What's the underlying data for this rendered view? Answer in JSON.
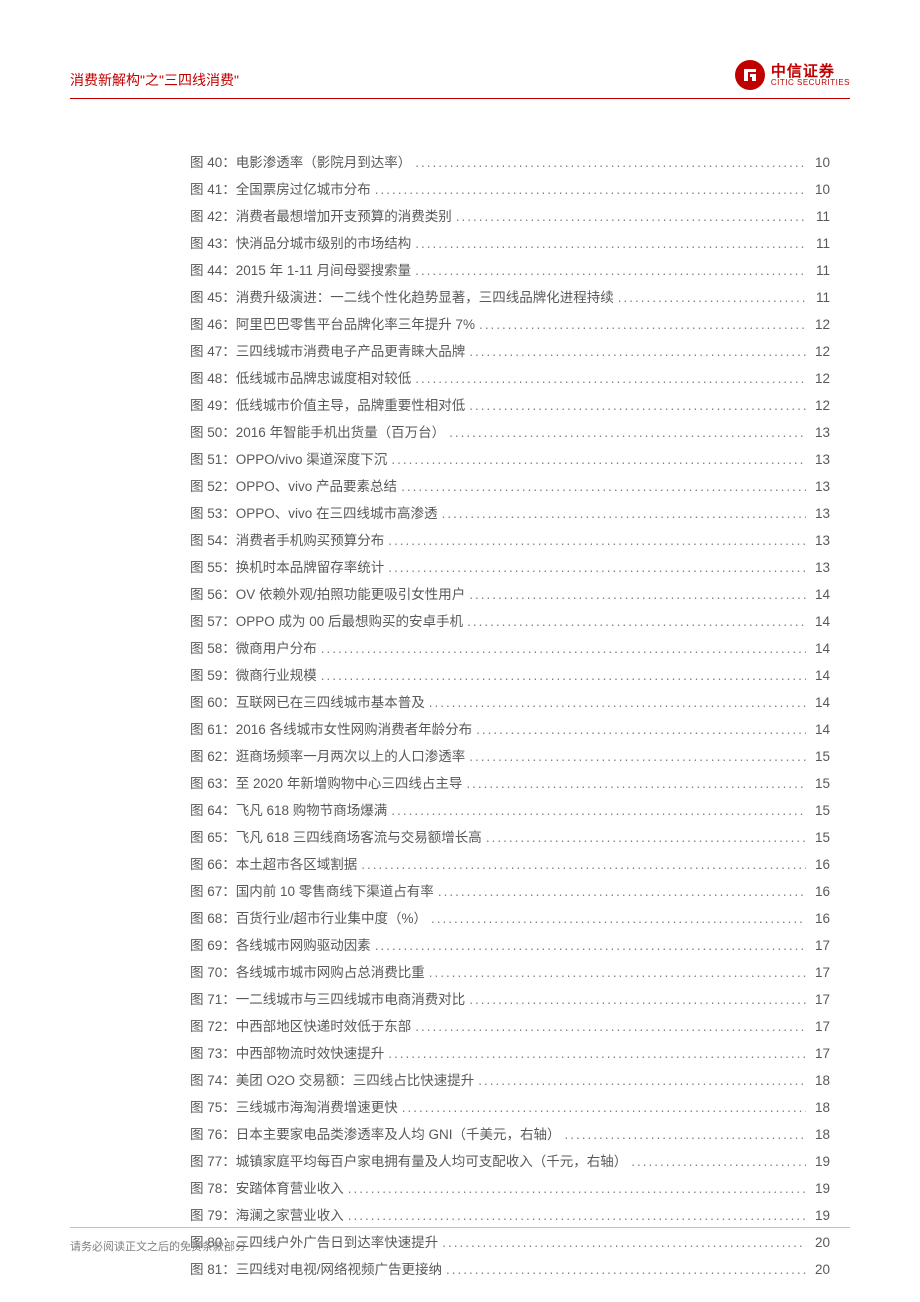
{
  "header": {
    "title": "消费新解构\"之\"三四线消费\"",
    "logo_cn": "中信证券",
    "logo_en": "CITIC SECURITIES"
  },
  "toc_prefix": "图 ",
  "toc_separator": "：",
  "toc": [
    {
      "num": "40",
      "title": "电影渗透率（影院月到达率）",
      "page": "10"
    },
    {
      "num": "41",
      "title": "全国票房过亿城市分布",
      "page": "10"
    },
    {
      "num": "42",
      "title": "消费者最想增加开支预算的消费类别",
      "page": "11"
    },
    {
      "num": "43",
      "title": "快消品分城市级别的市场结构",
      "page": "11"
    },
    {
      "num": "44",
      "title": "2015 年 1-11 月间母婴搜索量",
      "page": "11"
    },
    {
      "num": "45",
      "title": "消费升级演进：一二线个性化趋势显著，三四线品牌化进程持续",
      "page": "11"
    },
    {
      "num": "46",
      "title": "阿里巴巴零售平台品牌化率三年提升 7%",
      "page": "12"
    },
    {
      "num": "47",
      "title": "三四线城市消费电子产品更青睐大品牌",
      "page": "12"
    },
    {
      "num": "48",
      "title": "低线城市品牌忠诚度相对较低",
      "page": "12"
    },
    {
      "num": "49",
      "title": "低线城市价值主导，品牌重要性相对低",
      "page": "12"
    },
    {
      "num": "50",
      "title": "2016 年智能手机出货量（百万台）",
      "page": "13"
    },
    {
      "num": "51",
      "title": "OPPO/vivo 渠道深度下沉",
      "page": "13"
    },
    {
      "num": "52",
      "title": "OPPO、vivo 产品要素总结",
      "page": "13"
    },
    {
      "num": "53",
      "title": "OPPO、vivo 在三四线城市高渗透",
      "page": "13"
    },
    {
      "num": "54",
      "title": "消费者手机购买预算分布",
      "page": "13"
    },
    {
      "num": "55",
      "title": "换机时本品牌留存率统计",
      "page": "13"
    },
    {
      "num": "56",
      "title": "OV 依赖外观/拍照功能更吸引女性用户",
      "page": "14"
    },
    {
      "num": "57",
      "title": "OPPO 成为 00 后最想购买的安卓手机",
      "page": "14"
    },
    {
      "num": "58",
      "title": "微商用户分布",
      "page": "14"
    },
    {
      "num": "59",
      "title": "微商行业规模",
      "page": "14"
    },
    {
      "num": "60",
      "title": "互联网已在三四线城市基本普及",
      "page": "14"
    },
    {
      "num": "61",
      "title": "2016 各线城市女性网购消费者年龄分布",
      "page": "14"
    },
    {
      "num": "62",
      "title": "逛商场频率一月两次以上的人口渗透率",
      "page": "15"
    },
    {
      "num": "63",
      "title": "至 2020 年新增购物中心三四线占主导",
      "page": "15"
    },
    {
      "num": "64",
      "title": "飞凡 618 购物节商场爆满",
      "page": "15"
    },
    {
      "num": "65",
      "title": "飞凡 618 三四线商场客流与交易额增长高",
      "page": "15"
    },
    {
      "num": "66",
      "title": "本土超市各区域割据",
      "page": "16"
    },
    {
      "num": "67",
      "title": "国内前 10 零售商线下渠道占有率",
      "page": "16"
    },
    {
      "num": "68",
      "title": "百货行业/超市行业集中度（%）",
      "page": "16"
    },
    {
      "num": "69",
      "title": "各线城市网购驱动因素",
      "page": "17"
    },
    {
      "num": "70",
      "title": "各线城市城市网购占总消费比重",
      "page": "17"
    },
    {
      "num": "71",
      "title": "一二线城市与三四线城市电商消费对比",
      "page": "17"
    },
    {
      "num": "72",
      "title": "中西部地区快递时效低于东部",
      "page": "17"
    },
    {
      "num": "73",
      "title": "中西部物流时效快速提升",
      "page": "17"
    },
    {
      "num": "74",
      "title": "美团 O2O 交易额：三四线占比快速提升",
      "page": "18"
    },
    {
      "num": "75",
      "title": "三线城市海淘消费增速更快",
      "page": "18"
    },
    {
      "num": "76",
      "title": "日本主要家电品类渗透率及人均 GNI（千美元，右轴）",
      "page": "18"
    },
    {
      "num": "77",
      "title": "城镇家庭平均每百户家电拥有量及人均可支配收入（千元，右轴）",
      "page": "19"
    },
    {
      "num": "78",
      "title": "安踏体育营业收入",
      "page": "19"
    },
    {
      "num": "79",
      "title": "海澜之家营业收入",
      "page": "19"
    },
    {
      "num": "80",
      "title": "三四线户外广告日到达率快速提升",
      "page": "20"
    },
    {
      "num": "81",
      "title": "三四线对电视/网络视频广告更接纳",
      "page": "20"
    }
  ],
  "footer": {
    "disclaimer": "请务必阅读正文之后的免责条款部分"
  }
}
